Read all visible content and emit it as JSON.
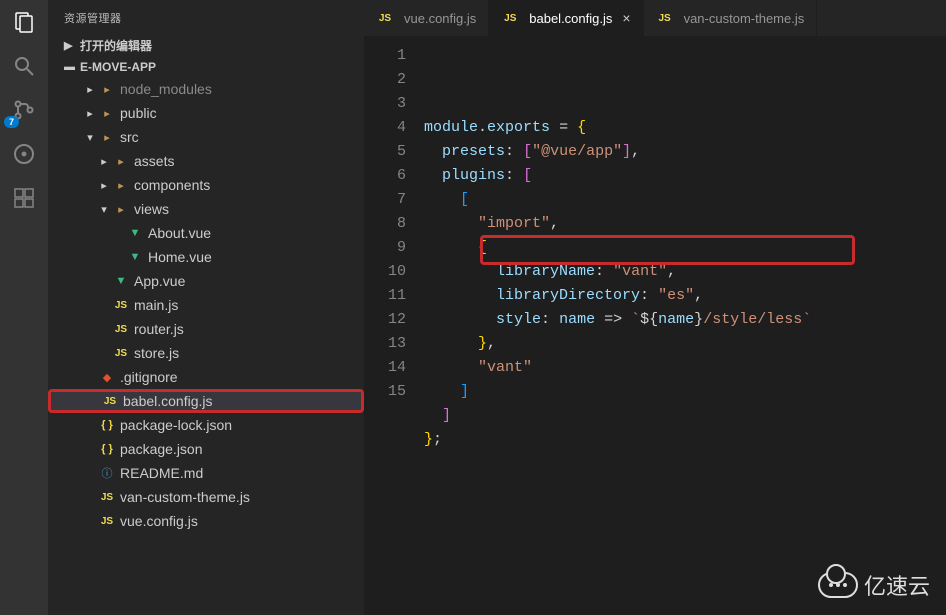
{
  "sidebar": {
    "title": "资源管理器",
    "sections": {
      "openEditors": "打开的编辑器",
      "project": "E-MOVE-APP"
    },
    "tree": [
      {
        "name": "node_modules",
        "type": "folder",
        "depth": 1,
        "dim": true,
        "expanded": false
      },
      {
        "name": "public",
        "type": "folder",
        "depth": 1,
        "expanded": false
      },
      {
        "name": "src",
        "type": "folder",
        "depth": 1,
        "expanded": true
      },
      {
        "name": "assets",
        "type": "folder",
        "depth": 2,
        "expanded": false
      },
      {
        "name": "components",
        "type": "folder",
        "depth": 2,
        "expanded": false
      },
      {
        "name": "views",
        "type": "folder",
        "depth": 2,
        "expanded": true
      },
      {
        "name": "About.vue",
        "type": "vue",
        "depth": 3
      },
      {
        "name": "Home.vue",
        "type": "vue",
        "depth": 3
      },
      {
        "name": "App.vue",
        "type": "vue",
        "depth": 2
      },
      {
        "name": "main.js",
        "type": "js",
        "depth": 2
      },
      {
        "name": "router.js",
        "type": "js",
        "depth": 2
      },
      {
        "name": "store.js",
        "type": "js",
        "depth": 2
      },
      {
        "name": ".gitignore",
        "type": "git",
        "depth": 1
      },
      {
        "name": "babel.config.js",
        "type": "js",
        "depth": 1,
        "active": true,
        "boxed": true
      },
      {
        "name": "package-lock.json",
        "type": "json",
        "depth": 1
      },
      {
        "name": "package.json",
        "type": "json",
        "depth": 1
      },
      {
        "name": "README.md",
        "type": "info",
        "depth": 1
      },
      {
        "name": "van-custom-theme.js",
        "type": "js",
        "depth": 1
      },
      {
        "name": "vue.config.js",
        "type": "js",
        "depth": 1
      }
    ]
  },
  "activity": {
    "badge": "7"
  },
  "tabs": [
    {
      "label": "vue.config.js",
      "icon": "js",
      "active": false
    },
    {
      "label": "babel.config.js",
      "icon": "js",
      "active": true
    },
    {
      "label": "van-custom-theme.js",
      "icon": "js",
      "active": false
    }
  ],
  "code": {
    "lines": [
      {
        "n": 1,
        "html": "<span class='tok-var'>module</span><span class='tok-op'>.</span><span class='tok-var'>exports</span> <span class='tok-op'>=</span> <span class='tok-brk'>{</span>"
      },
      {
        "n": 2,
        "html": "  <span class='tok-prop'>presets</span><span class='tok-op'>:</span> <span class='tok-brk2'>[</span><span class='tok-str'>\"@vue/app\"</span><span class='tok-brk2'>]</span><span class='tok-op'>,</span>"
      },
      {
        "n": 3,
        "html": "  <span class='tok-prop'>plugins</span><span class='tok-op'>:</span> <span class='tok-brk2'>[</span>"
      },
      {
        "n": 4,
        "html": "    <span class='tok-brk3'>[</span>"
      },
      {
        "n": 5,
        "html": "      <span class='tok-str'>\"import\"</span><span class='tok-op'>,</span>"
      },
      {
        "n": 6,
        "html": "      <span class='tok-brk'>{</span>"
      },
      {
        "n": 7,
        "html": "        <span class='tok-prop'>libraryName</span><span class='tok-op'>:</span> <span class='tok-str'>\"vant\"</span><span class='tok-op'>,</span>"
      },
      {
        "n": 8,
        "html": "        <span class='tok-prop'>libraryDirectory</span><span class='tok-op'>:</span> <span class='tok-str'>\"es\"</span><span class='tok-op'>,</span>"
      },
      {
        "n": 9,
        "html": "        <span class='tok-prop'>style</span><span class='tok-op'>:</span> <span class='tok-var'>name</span> <span class='tok-op'>=&gt;</span> <span class='tok-str'>`</span><span class='tok-op'>${</span><span class='tok-var'>name</span><span class='tok-op'>}</span><span class='tok-str'>/style/less`</span>"
      },
      {
        "n": 10,
        "html": "      <span class='tok-brk'>}</span><span class='tok-op'>,</span>"
      },
      {
        "n": 11,
        "html": "      <span class='tok-str'>\"vant\"</span>"
      },
      {
        "n": 12,
        "html": "    <span class='tok-brk3'>]</span>"
      },
      {
        "n": 13,
        "html": "  <span class='tok-brk2'>]</span>"
      },
      {
        "n": 14,
        "html": "<span class='tok-brk'>}</span><span class='tok-op'>;</span>"
      },
      {
        "n": 15,
        "html": ""
      }
    ]
  },
  "watermark": "亿速云"
}
